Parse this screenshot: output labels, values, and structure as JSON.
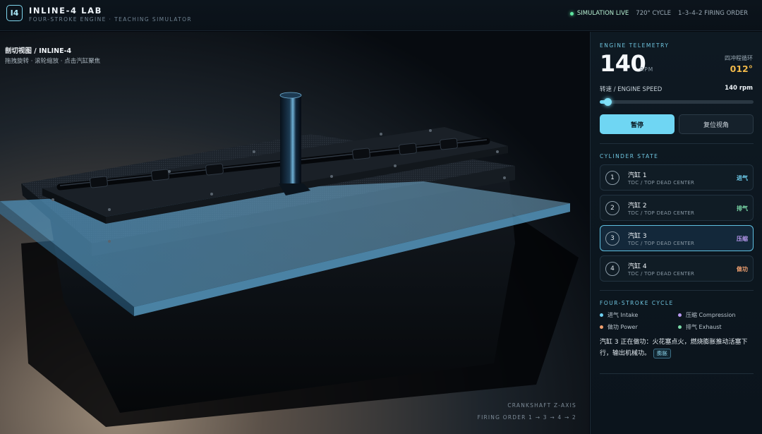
{
  "header": {
    "logo": "I4",
    "title": "INLINE-4 LAB",
    "subtitle": "FOUR-STROKE ENGINE · TEACHING SIMULATOR",
    "live": "SIMULATION LIVE",
    "cycle": "720° CYCLE",
    "firing": "1–3–4–2 FIRING ORDER"
  },
  "viewport": {
    "title": "剖切视图 / INLINE-4",
    "hint": "拖拽旋转 · 滚轮缩放 · 点击汽缸聚焦",
    "axis_caption": "CRANKSHAFT Z-AXIS",
    "order_caption": "FIRING ORDER 1 → 3 → 4 → 2"
  },
  "telemetry": {
    "section": "ENGINE TELEMETRY",
    "rpm": "140",
    "rpm_unit": "RPM",
    "cycle_label": "四冲程循环",
    "cycle_angle": "012°",
    "speed_label": "转速 / ENGINE SPEED",
    "speed_value": "140 rpm",
    "speed_fraction": 0.05,
    "pause_label": "暂停",
    "reset_label": "复位视角"
  },
  "cylinders": {
    "section": "CYLINDER STATE",
    "items": [
      {
        "num": "1",
        "name": "汽缸 1",
        "sub": "TDC / TOP DEAD CENTER",
        "stroke": "进气",
        "color": "#6fd0f0",
        "active": false
      },
      {
        "num": "2",
        "name": "汽缸 2",
        "sub": "TDC / TOP DEAD CENTER",
        "stroke": "排气",
        "color": "#7ad9a8",
        "active": false
      },
      {
        "num": "3",
        "name": "汽缸 3",
        "sub": "TDC / TOP DEAD CENTER",
        "stroke": "压缩",
        "color": "#b89af0",
        "active": true
      },
      {
        "num": "4",
        "name": "汽缸 4",
        "sub": "TDC / TOP DEAD CENTER",
        "stroke": "做功",
        "color": "#f0a070",
        "active": false
      }
    ]
  },
  "cycle": {
    "section": "FOUR-STROKE CYCLE",
    "legend": [
      {
        "label": "进气 Intake",
        "color": "#6fd0f0"
      },
      {
        "label": "压缩 Compression",
        "color": "#b89af0"
      },
      {
        "label": "做功 Power",
        "color": "#f0a070"
      },
      {
        "label": "排气 Exhaust",
        "color": "#7ad9a8"
      }
    ],
    "description": "汽缸 3 正在做功：火花塞点火，燃烧膨胀推动活塞下行，输出机械功。",
    "tag": "膨胀"
  },
  "colors": {
    "accent": "#6fd6f3",
    "live": "#5ee6a0",
    "angle": "#f0b84a"
  }
}
